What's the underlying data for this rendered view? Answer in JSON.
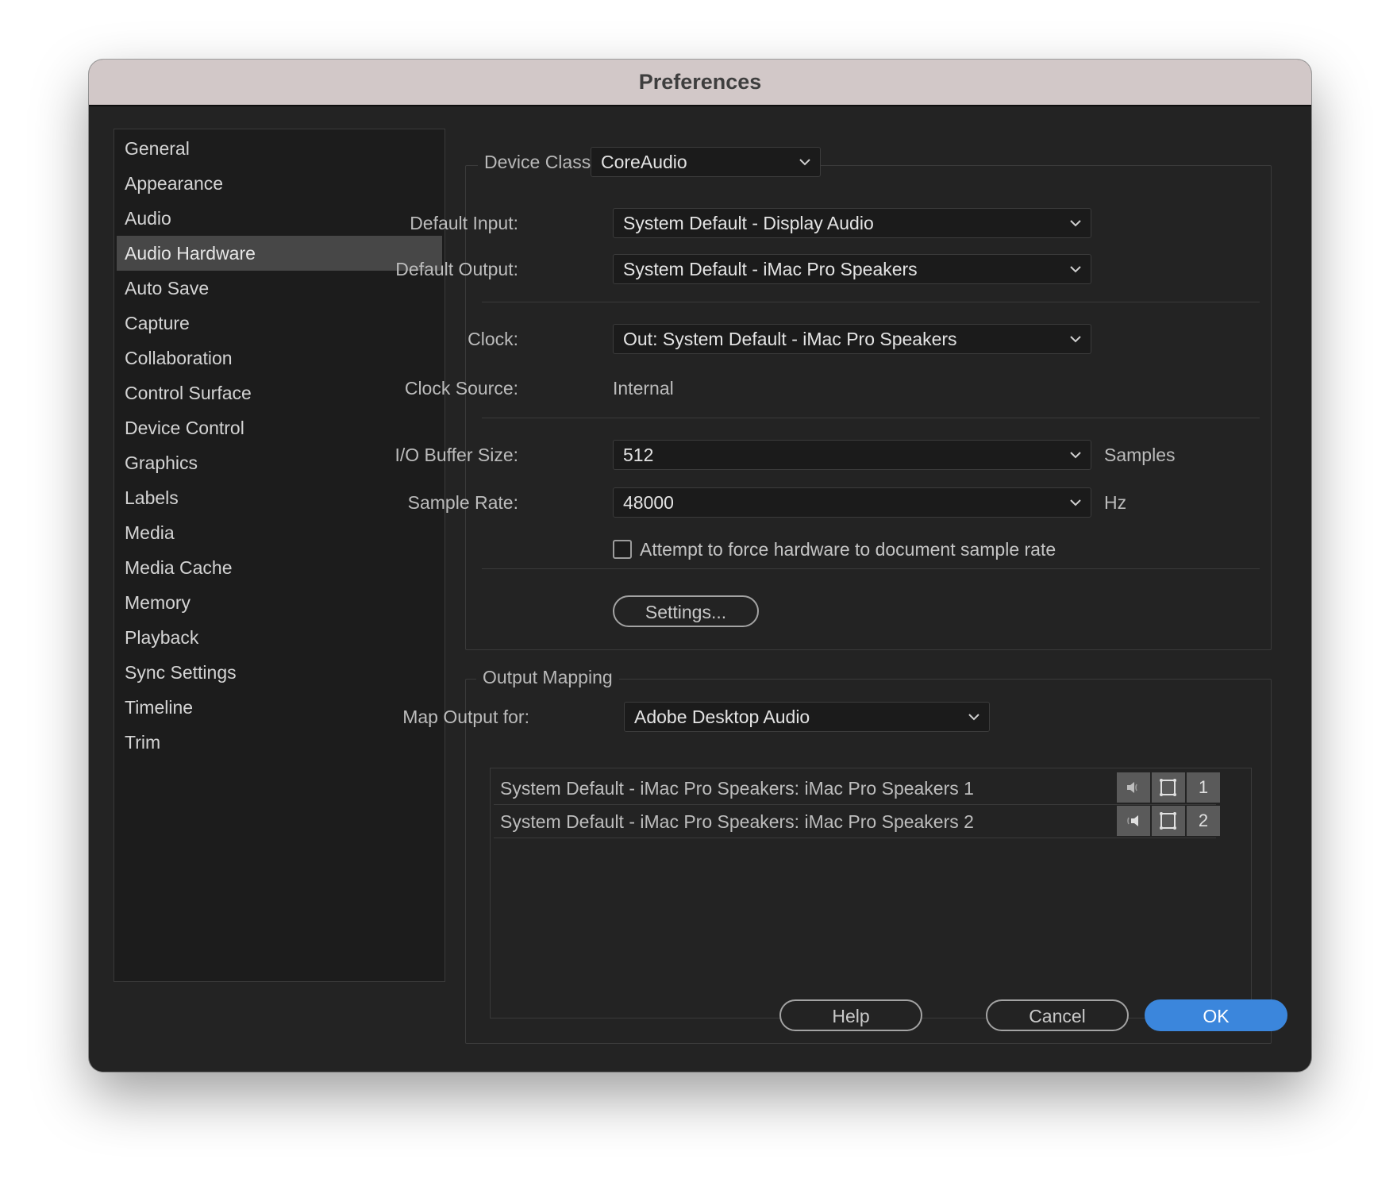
{
  "window": {
    "title": "Preferences"
  },
  "sidebar": {
    "items": [
      {
        "label": "General",
        "selected": false
      },
      {
        "label": "Appearance",
        "selected": false
      },
      {
        "label": "Audio",
        "selected": false
      },
      {
        "label": "Audio Hardware",
        "selected": true
      },
      {
        "label": "Auto Save",
        "selected": false
      },
      {
        "label": "Capture",
        "selected": false
      },
      {
        "label": "Collaboration",
        "selected": false
      },
      {
        "label": "Control Surface",
        "selected": false
      },
      {
        "label": "Device Control",
        "selected": false
      },
      {
        "label": "Graphics",
        "selected": false
      },
      {
        "label": "Labels",
        "selected": false
      },
      {
        "label": "Media",
        "selected": false
      },
      {
        "label": "Media Cache",
        "selected": false
      },
      {
        "label": "Memory",
        "selected": false
      },
      {
        "label": "Playback",
        "selected": false
      },
      {
        "label": "Sync Settings",
        "selected": false
      },
      {
        "label": "Timeline",
        "selected": false
      },
      {
        "label": "Trim",
        "selected": false
      }
    ]
  },
  "hardware": {
    "device_class_label": "Device Class:",
    "device_class_value": "CoreAudio",
    "default_input_label": "Default Input:",
    "default_input_value": "System Default - Display Audio",
    "default_output_label": "Default Output:",
    "default_output_value": "System Default - iMac Pro Speakers",
    "clock_label": "Clock:",
    "clock_value": "Out: System Default - iMac Pro Speakers",
    "clock_source_label": "Clock Source:",
    "clock_source_value": "Internal",
    "buffer_label": "I/O Buffer Size:",
    "buffer_value": "512",
    "buffer_unit": "Samples",
    "sample_rate_label": "Sample Rate:",
    "sample_rate_value": "48000",
    "sample_rate_unit": "Hz",
    "force_rate_label": "Attempt to force hardware to document sample rate",
    "force_rate_checked": false,
    "settings_button": "Settings..."
  },
  "output_mapping": {
    "title": "Output Mapping",
    "map_for_label": "Map Output for:",
    "map_for_value": "Adobe Desktop Audio",
    "rows": [
      {
        "label": "System Default - iMac Pro Speakers: iMac Pro Speakers 1",
        "channel": "1",
        "icon": "speaker-left-icon"
      },
      {
        "label": "System Default - iMac Pro Speakers: iMac Pro Speakers 2",
        "channel": "2",
        "icon": "speaker-right-icon"
      }
    ]
  },
  "footer": {
    "help": "Help",
    "cancel": "Cancel",
    "ok": "OK"
  },
  "colors": {
    "accent": "#3b86dc",
    "window_bg": "#232323",
    "titlebar_bg": "#d2c8c8",
    "selected_item_bg": "#474747"
  }
}
